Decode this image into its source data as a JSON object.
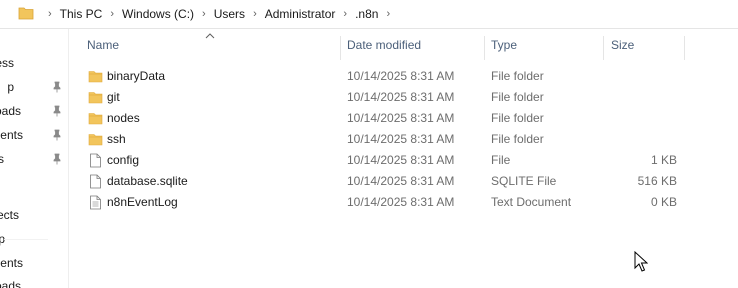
{
  "address_bar": {
    "breadcrumbs": [
      "This PC",
      "Windows (C:)",
      "Users",
      "Administrator",
      ".n8n"
    ]
  },
  "nav_pane": {
    "items": [
      {
        "label": "ccess",
        "pinned": false
      },
      {
        "label": "p",
        "pinned": true
      },
      {
        "label": "oads",
        "pinned": true
      },
      {
        "label": "ments",
        "pinned": true
      },
      {
        "label": "s",
        "pinned": true
      },
      {
        "label": "ects",
        "pinned": false
      },
      {
        "label": "p",
        "pinned": false
      },
      {
        "label": "ments",
        "pinned": false
      },
      {
        "label": "oads",
        "pinned": false
      }
    ]
  },
  "columns": {
    "name": "Name",
    "date_modified": "Date modified",
    "type": "Type",
    "size": "Size"
  },
  "files": [
    {
      "name": "binaryData",
      "date": "10/14/2025 8:31 AM",
      "type": "File folder",
      "size": "",
      "icon": "folder-icon"
    },
    {
      "name": "git",
      "date": "10/14/2025 8:31 AM",
      "type": "File folder",
      "size": "",
      "icon": "folder-icon"
    },
    {
      "name": "nodes",
      "date": "10/14/2025 8:31 AM",
      "type": "File folder",
      "size": "",
      "icon": "folder-icon"
    },
    {
      "name": "ssh",
      "date": "10/14/2025 8:31 AM",
      "type": "File folder",
      "size": "",
      "icon": "folder-icon"
    },
    {
      "name": "config",
      "date": "10/14/2025 8:31 AM",
      "type": "File",
      "size": "1 KB",
      "icon": "file-icon"
    },
    {
      "name": "database.sqlite",
      "date": "10/14/2025 8:31 AM",
      "type": "SQLITE File",
      "size": "516 KB",
      "icon": "file-icon"
    },
    {
      "name": "n8nEventLog",
      "date": "10/14/2025 8:31 AM",
      "type": "Text Document",
      "size": "0 KB",
      "icon": "text-file-icon"
    }
  ],
  "colors": {
    "folder": "#f2c55c",
    "folder_dark": "#e0a93a",
    "header_text": "#4c607a",
    "detail_text": "#6d6d6d"
  }
}
